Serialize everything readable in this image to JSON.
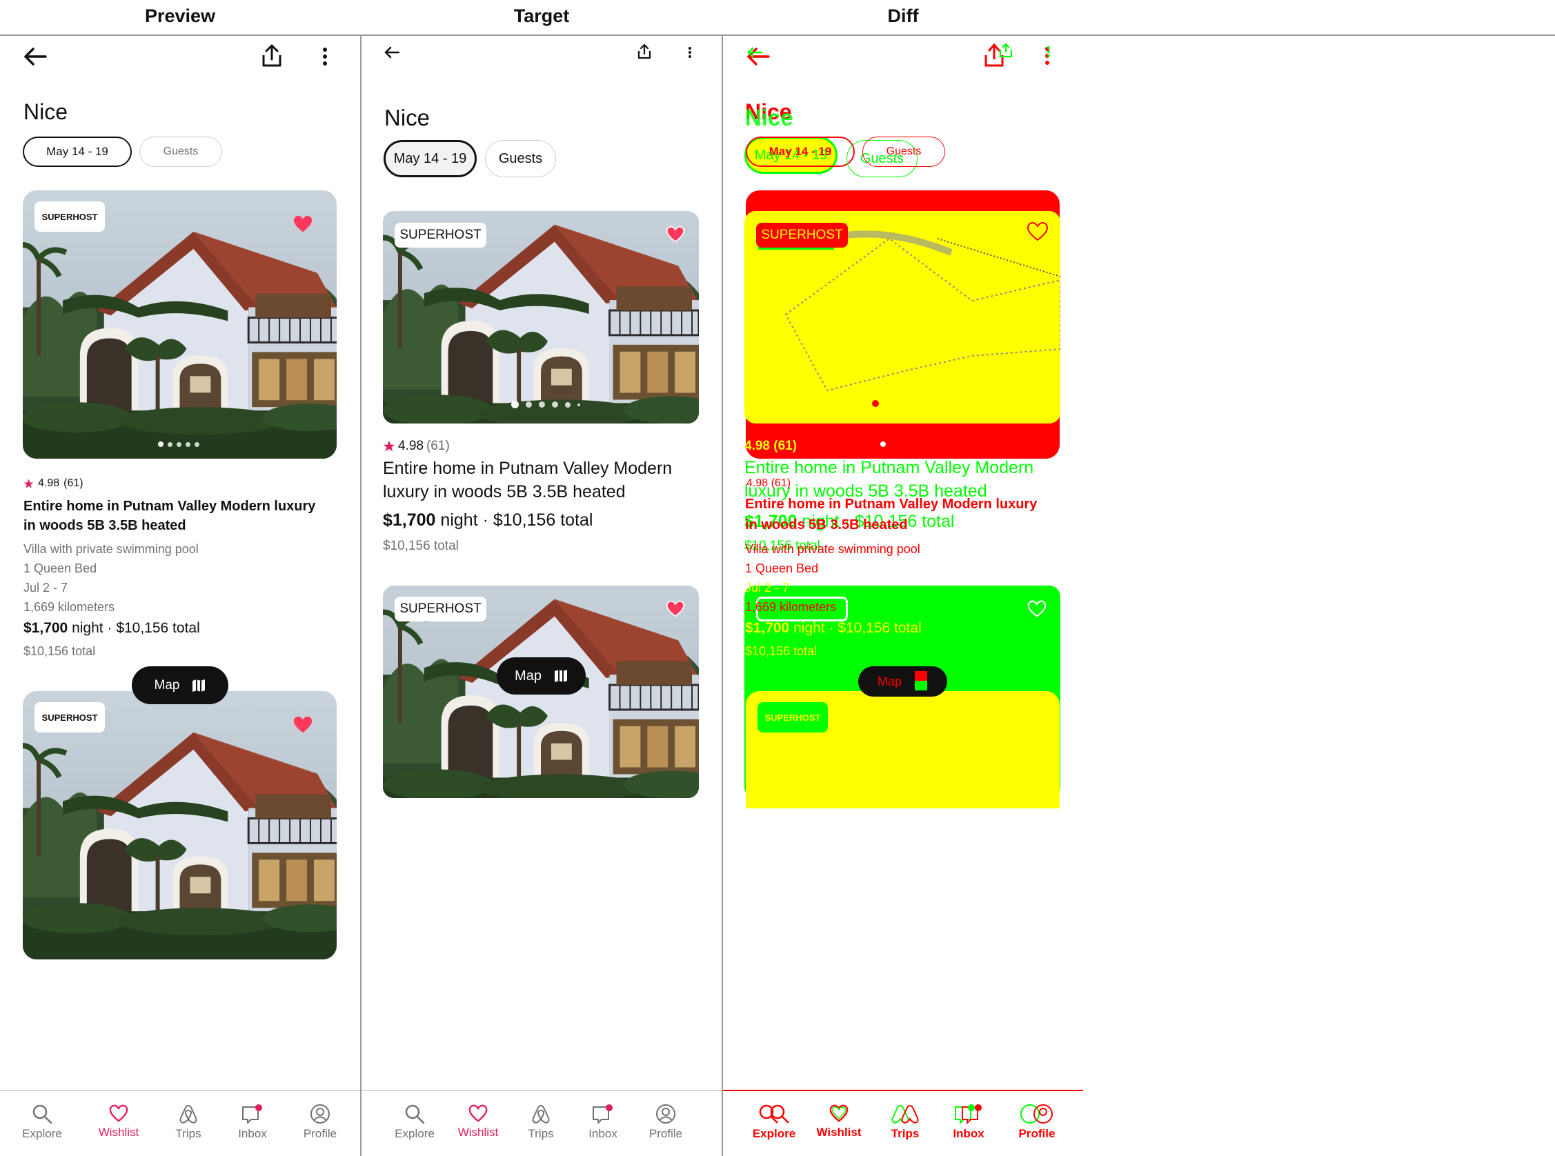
{
  "headers": {
    "preview": "Preview",
    "target": "Target",
    "diff": "Diff"
  },
  "listing": {
    "city": "Nice",
    "dates": "May 14 - 19",
    "guests": "Guests",
    "badge": "SUPERHOST",
    "rating": "4.98",
    "reviews": "(61)",
    "title_full": "Entire home in Putnam Valley Modern luxury in woods 5B 3.5B heated",
    "title_line1_preview": "Entire home in Putnam Valley Modern luxury",
    "title_line2_preview": "in woods 5B 3.5B heated",
    "title_line1_target": "Entire home in Putnam Valley Modern",
    "title_line2_target": "luxury in woods 5B 3.5B heated",
    "subtitle": "Villa with private swimming pool",
    "beds": "1 Queen Bed",
    "available_dates": "Jul 2 - 7",
    "distance": "1,669 kilometers",
    "price": "$1,700",
    "price_unit": "night",
    "separator": "·",
    "total": "$10,156 total",
    "total_secondary": "$10,156 total",
    "photo_count": 5,
    "active_photo": 1
  },
  "map_button": {
    "label": "Map",
    "icon": "map-icon"
  },
  "tabs": [
    {
      "label": "Explore",
      "icon": "search-icon"
    },
    {
      "label": "Wishlist",
      "icon": "heart-icon",
      "active": true
    },
    {
      "label": "Trips",
      "icon": "airbnb-logo-icon"
    },
    {
      "label": "Inbox",
      "icon": "message-icon",
      "notification": true
    },
    {
      "label": "Profile",
      "icon": "profile-icon"
    }
  ],
  "colors": {
    "brand": "#e31c5f",
    "heart": "#ff385c",
    "text": "#111111",
    "muted": "#717171",
    "diff_red": "#ff0000",
    "diff_green": "#00ff00",
    "diff_yellow": "#ffff00"
  }
}
